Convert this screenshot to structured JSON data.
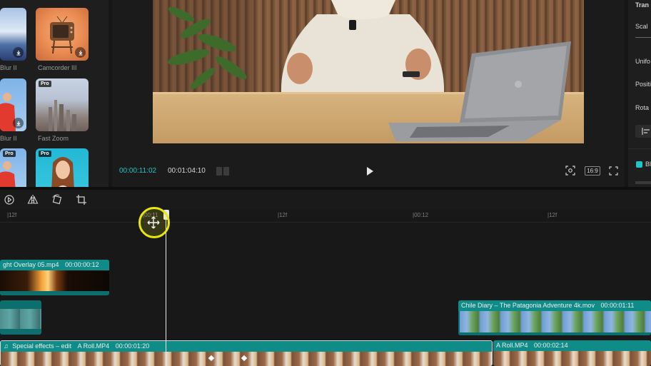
{
  "library": {
    "items": [
      {
        "label": "Blur II",
        "icon": "download-icon"
      },
      {
        "label": "Camcorder III",
        "icon": "download-icon"
      },
      {
        "label": "Blur II",
        "icon": "download-icon"
      },
      {
        "label": "Fast Zoom",
        "badge": "Pro"
      },
      {
        "badge": "Pro"
      },
      {
        "badge": "Pro"
      }
    ]
  },
  "player": {
    "current_time": "00:00:11:02",
    "total_time": "00:01:04:10",
    "ratio": "16:9",
    "icons": [
      "play-icon",
      "screenshot-icon",
      "fullscreen-icon"
    ]
  },
  "properties": {
    "title": "Tran",
    "tab": "Scal",
    "rows": [
      "Unifo",
      "Positi",
      "Rota"
    ],
    "toggle_label": "Bl",
    "colors": {
      "accent": "#1fc4c9"
    }
  },
  "toolbar": {
    "icons": [
      "reverse-icon",
      "mirror-icon",
      "rotate-icon",
      "crop-icon"
    ]
  },
  "timeline": {
    "ticks": [
      "|12f",
      "|00:11",
      "|12f",
      "|00:12",
      "|12f"
    ],
    "clips": {
      "overlay": {
        "name": "ght Overlay 05.mp4",
        "duration": "00:00:00:12"
      },
      "chile": {
        "name": "Chile Diary – The Patagonia Adventure 4k.mov",
        "duration": "00:00:01:11"
      },
      "main": {
        "prefix": "Special effects – edit",
        "name": "A Roll.MP4",
        "duration": "00:00:01:20"
      },
      "main2": {
        "name": "A Roll.MP4",
        "duration": "00:00:02:14"
      }
    },
    "colors": {
      "clip_teal": "#0c6f6d",
      "clip_header": "#0f8c88",
      "cursor_highlight": "#e7e80f"
    }
  }
}
